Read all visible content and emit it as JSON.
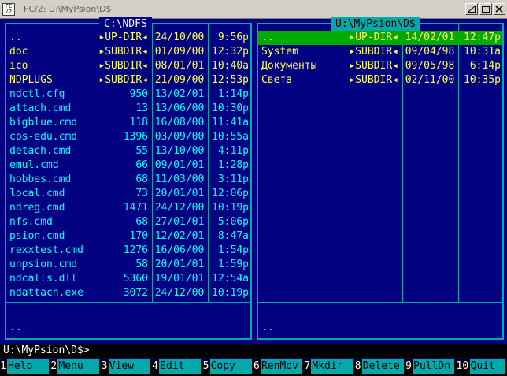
{
  "window": {
    "title": "FC/2: U:\\MyPsion\\D$",
    "icon": "app-icon",
    "buttons": [
      "restore",
      "maximize",
      "close"
    ]
  },
  "left_panel": {
    "title": "C:\\NDFS",
    "active": false,
    "footer": "..",
    "rows": [
      {
        "name": "..",
        "size": "▸UP-DIR◂",
        "date": "24/10/00",
        "time": "9:56p",
        "kind": "up"
      },
      {
        "name": "doc",
        "size": "▸SUBDIR◂",
        "date": "01/09/00",
        "time": "12:32p",
        "kind": "dir"
      },
      {
        "name": "ico",
        "size": "▸SUBDIR◂",
        "date": "08/01/01",
        "time": "10:40a",
        "kind": "dir"
      },
      {
        "name": "NDPLUGS",
        "size": "▸SUBDIR◂",
        "date": "21/09/00",
        "time": "12:53p",
        "kind": "dir"
      },
      {
        "name": "ndctl.cfg",
        "size": "950",
        "date": "13/02/01",
        "time": "1:14p",
        "kind": "file"
      },
      {
        "name": "attach.cmd",
        "size": "13",
        "date": "13/06/00",
        "time": "10:30p",
        "kind": "file"
      },
      {
        "name": "bigblue.cmd",
        "size": "118",
        "date": "16/08/00",
        "time": "11:41a",
        "kind": "file"
      },
      {
        "name": "cbs-edu.cmd",
        "size": "1396",
        "date": "03/09/00",
        "time": "10:55a",
        "kind": "file"
      },
      {
        "name": "detach.cmd",
        "size": "55",
        "date": "13/10/00",
        "time": "4:11p",
        "kind": "file"
      },
      {
        "name": "emul.cmd",
        "size": "66",
        "date": "09/01/01",
        "time": "1:28p",
        "kind": "file"
      },
      {
        "name": "hobbes.cmd",
        "size": "68",
        "date": "11/03/00",
        "time": "3:11p",
        "kind": "file"
      },
      {
        "name": "local.cmd",
        "size": "73",
        "date": "20/01/01",
        "time": "12:06p",
        "kind": "file"
      },
      {
        "name": "ndreg.cmd",
        "size": "1471",
        "date": "24/12/00",
        "time": "10:19p",
        "kind": "file"
      },
      {
        "name": "nfs.cmd",
        "size": "68",
        "date": "27/01/01",
        "time": "5:06p",
        "kind": "file"
      },
      {
        "name": "psion.cmd",
        "size": "170",
        "date": "12/02/01",
        "time": "8:47a",
        "kind": "file"
      },
      {
        "name": "rexxtest.cmd",
        "size": "1276",
        "date": "16/06/00",
        "time": "1:54p",
        "kind": "file"
      },
      {
        "name": "unpsion.cmd",
        "size": "58",
        "date": "20/01/01",
        "time": "1:59p",
        "kind": "file"
      },
      {
        "name": "ndcalls.dll",
        "size": "5360",
        "date": "19/01/01",
        "time": "12:54a",
        "kind": "file"
      },
      {
        "name": "ndattach.exe",
        "size": "3072",
        "date": "24/12/00",
        "time": "10:19p",
        "kind": "file"
      }
    ]
  },
  "right_panel": {
    "title": "U:\\MyPsion\\D$",
    "active": true,
    "footer": "..",
    "rows": [
      {
        "name": "..",
        "size": "▸UP-DIR◂",
        "date": "14/02/01",
        "time": "12:47p",
        "kind": "up",
        "cursor": true
      },
      {
        "name": "System",
        "size": "▸SUBDIR◂",
        "date": "09/04/98",
        "time": "10:31a",
        "kind": "dir"
      },
      {
        "name": "Документы",
        "size": "▸SUBDIR◂",
        "date": "09/05/98",
        "time": "6:14p",
        "kind": "dir"
      },
      {
        "name": "Света",
        "size": "▸SUBDIR◂",
        "date": "02/11/00",
        "time": "10:35p",
        "kind": "dir"
      }
    ]
  },
  "command_line": "U:\\MyPsion\\D$>",
  "function_keys": [
    {
      "num": "1",
      "label": "Help"
    },
    {
      "num": "2",
      "label": "Menu"
    },
    {
      "num": "3",
      "label": "View"
    },
    {
      "num": "4",
      "label": "Edit"
    },
    {
      "num": "5",
      "label": "Copy"
    },
    {
      "num": "6",
      "label": "RenMov"
    },
    {
      "num": "7",
      "label": "Mkdir"
    },
    {
      "num": "8",
      "label": "Delete"
    },
    {
      "num": "9",
      "label": "PullDn"
    },
    {
      "num": "10",
      "label": "Quit"
    }
  ],
  "colors": {
    "background": "#000080",
    "border": "#00aaaa",
    "file_text": "#00ffff",
    "dir_text": "#ffff55",
    "cursor_bg": "#00aa00"
  }
}
